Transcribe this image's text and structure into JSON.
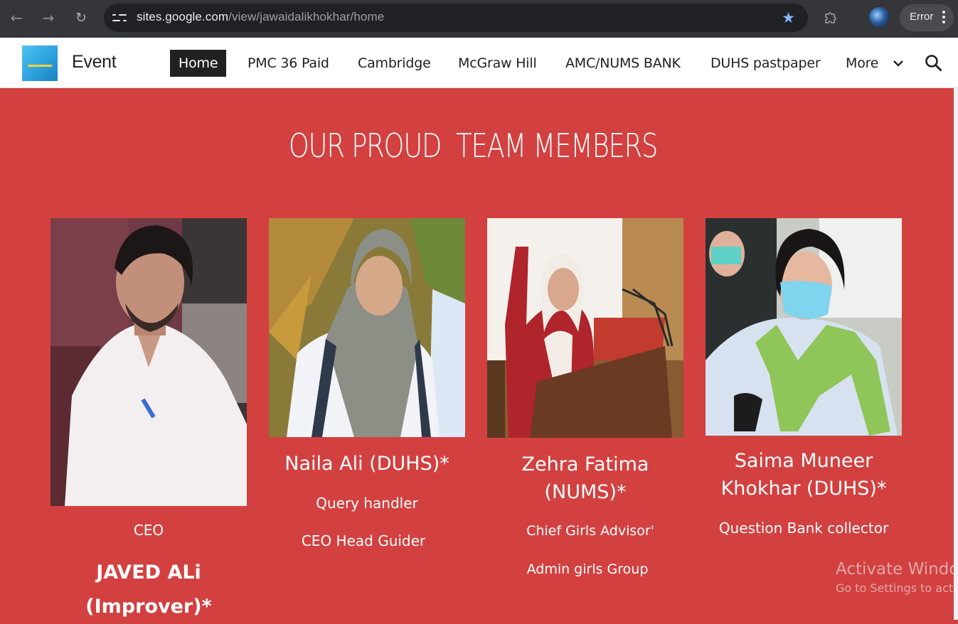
{
  "browser": {
    "url_host": "sites.google.com",
    "url_path": "/view/jawaidalikhokhar/home",
    "profile_status": "Error"
  },
  "site": {
    "title": "Event",
    "nav": [
      {
        "label": "Home",
        "active": true
      },
      {
        "label": "PMC 36 Paid"
      },
      {
        "label": "Cambridge"
      },
      {
        "label": "McGraw Hill"
      },
      {
        "label": "AMC/NUMS BANK"
      },
      {
        "label": "DUHS pastpaper"
      },
      {
        "label": "More"
      }
    ]
  },
  "section": {
    "title": "OUR PROUD  TEAM MEMBERS"
  },
  "members": [
    {
      "role_line1": "CEO",
      "name_line1": "JAVED ALi",
      "name_line2": "(Improver)*"
    },
    {
      "name": "Naila Ali (DUHS)*",
      "role_line1": "Query handler",
      "role_line2": "CEO Head Guider"
    },
    {
      "name_line1": "Zehra Fatima",
      "name_line2": "(NUMS)*",
      "role_line1": "Chief Girls Advisor'",
      "role_line2": "Admin girls Group"
    },
    {
      "name_line1": "Saima Muneer",
      "name_line2": "Khokhar (DUHS)*",
      "role_line1": "Question Bank collector"
    }
  ],
  "watermark": {
    "line1": "Activate Windo",
    "line2": "Go to Settings to acti"
  }
}
